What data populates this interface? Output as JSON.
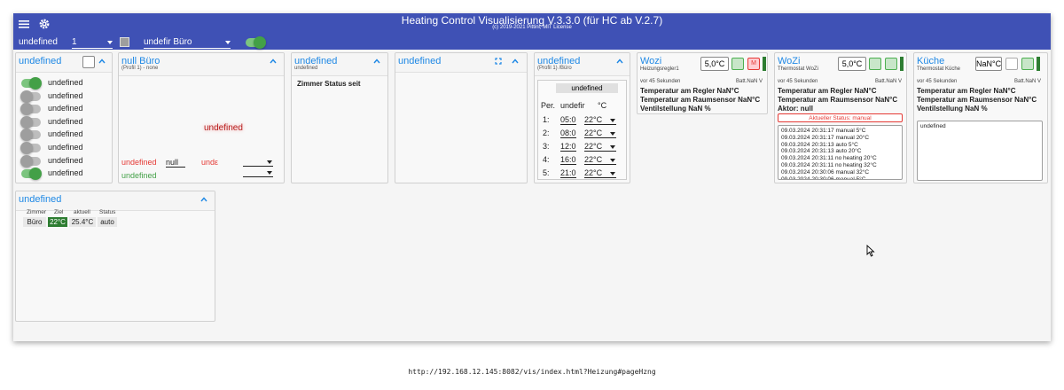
{
  "header": {
    "title": "Heating Control Visualisierung V.3.3.0 (für HC ab V.2.7)",
    "subtitle": "(c) 2019-2021 Pittini, MIT License"
  },
  "subbar": {
    "room_label": "undefined",
    "profile_value": "1",
    "room_select": "undefir Büro"
  },
  "card_rooms": {
    "title": "undefined",
    "items": [
      {
        "label": "undefined",
        "on": true
      },
      {
        "label": "undefined",
        "on": false
      },
      {
        "label": "undefined",
        "on": false
      },
      {
        "label": "undefined",
        "on": false
      },
      {
        "label": "undefined",
        "on": false
      },
      {
        "label": "undefined",
        "on": false
      },
      {
        "label": "undefined",
        "on": false
      },
      {
        "label": "undefined",
        "on": true
      }
    ]
  },
  "card_profile": {
    "title": "null Büro",
    "subtitle": "(Profil 1) - none",
    "center_text": "undefined",
    "red_label": "undefined",
    "null_value": "null",
    "red_short": "undε",
    "green_label": "undefined"
  },
  "card_status": {
    "title": "undefined",
    "subtitle": "undefined",
    "body": "Zimmer Status seit"
  },
  "card_empty": {
    "title": "undefined"
  },
  "card_schedule": {
    "title": "undefined",
    "subtitle": "(Profil 1) /Büro",
    "header": "undefined",
    "per_label": "Per.",
    "undef_label": "undefir",
    "unit": "°C",
    "periods": [
      {
        "n": "1:",
        "time": "05:0",
        "temp": "22°C"
      },
      {
        "n": "2:",
        "time": "08:0",
        "temp": "22°C"
      },
      {
        "n": "3:",
        "time": "12:0",
        "temp": "22°C"
      },
      {
        "n": "4:",
        "time": "16:0",
        "temp": "22°C"
      },
      {
        "n": "5:",
        "time": "21:0",
        "temp": "22°C"
      }
    ]
  },
  "thermo_wozi1": {
    "title": "Wozi",
    "subtitle": "Heizungsregler1",
    "setpoint": "5,0°C",
    "ago": "vor 45 Sekunden",
    "batt": "Batt.NaN V",
    "line1": "Temperatur am Regler NaN°C",
    "line2": "Temperatur am Raumsensor NaN°C",
    "line3": "Ventilstellung NaN %"
  },
  "thermo_wozi2": {
    "title": "WoZi",
    "subtitle": "Thermostat WoZi",
    "setpoint": "5,0°C",
    "ago": "vor 45 Sekunden",
    "batt": "Batt.NaN V",
    "line1": "Temperatur am Regler NaN°C",
    "line2": "Temperatur am Raumsensor NaN°C",
    "line3": "Aktor: null",
    "status": "Aktueller Status: manual",
    "log": [
      "09.03.2024 20:31:17 manual 5°C",
      "09.03.2024 20:31:17 manual 20°C",
      "09.03.2024 20:31:13 auto 5°C",
      "09.03.2024 20:31:13 auto 20°C",
      "09.03.2024 20:31:11 no heating 20°C",
      "09.03.2024 20:31:11 no heating 32°C",
      "09.03.2024 20:30:06 manual 32°C",
      "09.03.2024 20:30:06 manual 5°C"
    ]
  },
  "thermo_kueche": {
    "title": "Küche",
    "subtitle": "Thermostat Küche",
    "setpoint": "NaN°C",
    "ago": "vor 45 Sekunden",
    "batt": "Batt.NaN V",
    "line1": "Temperatur am Regler NaN°C",
    "line2": "Temperatur am Raumsensor NaN°C",
    "line3": "Ventilstellung NaN %",
    "log_text": "undefined"
  },
  "card_overview": {
    "title": "undefined",
    "columns": [
      "Zimmer",
      "Ziel",
      "aktuell",
      "Status"
    ],
    "row": {
      "room": "Büro",
      "target": "22°C",
      "current": "25.4°C",
      "status": "auto"
    }
  },
  "colors": {
    "brand": "#3f51b5",
    "accent": "#1e88e5",
    "ok": "#43a047",
    "alert": "#e53935"
  },
  "url": "http://192.168.12.145:8082/vis/index.html?Heizung#pageHzng"
}
